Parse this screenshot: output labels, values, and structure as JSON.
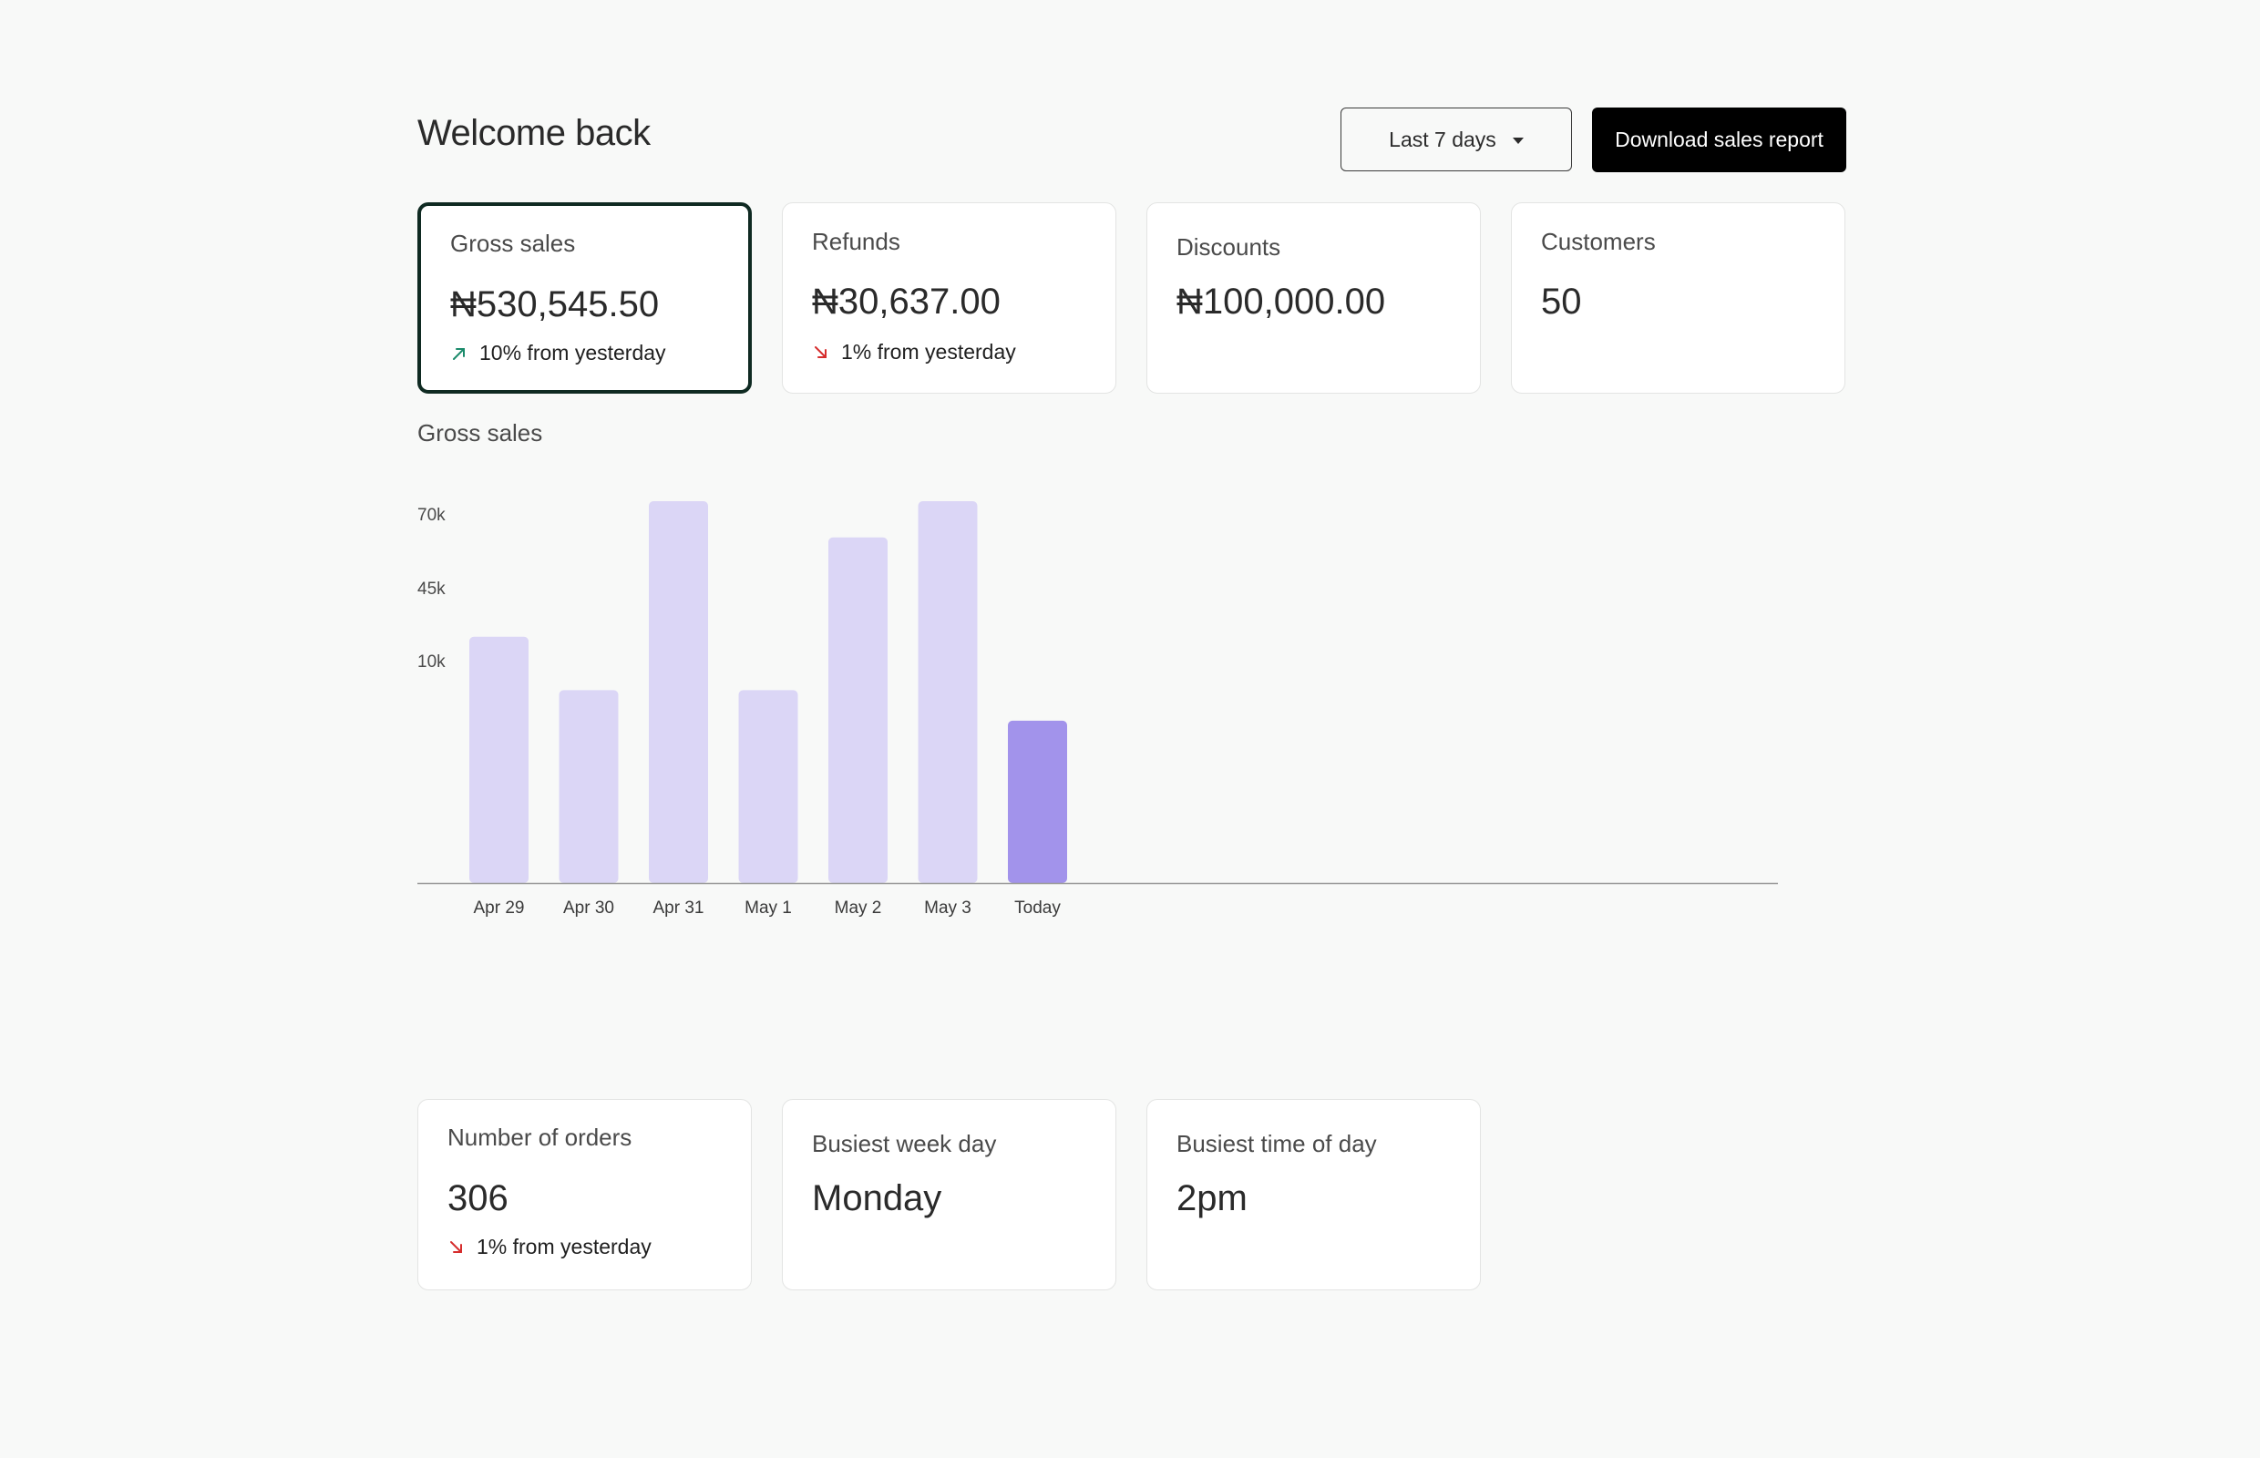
{
  "header": {
    "title": "Welcome back",
    "range_label": "Last 7 days",
    "download_label": "Download sales report"
  },
  "colors": {
    "selected_border": "#0f2a22",
    "bar": "#dbd6f6",
    "bar_highlight": "#a293eb",
    "up": "#1a8a6a",
    "down": "#d62d2d"
  },
  "stats": [
    {
      "label": "Gross sales",
      "value": "₦530,545.50",
      "delta": "10% from yesterday",
      "trend": "up",
      "selected": true
    },
    {
      "label": "Refunds",
      "value": "₦30,637.00",
      "delta": "1% from yesterday",
      "trend": "down"
    },
    {
      "label": "Discounts",
      "value": "₦100,000.00"
    },
    {
      "label": "Customers",
      "value": "50"
    }
  ],
  "chart_section_title": "Gross sales",
  "chart_data": {
    "type": "bar",
    "categories": [
      "Apr 29",
      "Apr 30",
      "Apr 31",
      "May 1",
      "May 2",
      "May 3",
      "Today"
    ],
    "values": [
      0.645,
      0.505,
      1.0,
      0.505,
      0.905,
      1.0,
      0.425
    ],
    "value_scale": "bar height as fraction of tallest bar",
    "highlight_index": 6,
    "yticks": [
      "70k",
      "45k",
      "10k"
    ],
    "grid": false
  },
  "stats2": [
    {
      "label": "Number of orders",
      "value": "306",
      "delta": "1% from yesterday",
      "trend": "down"
    },
    {
      "label": "Busiest week day",
      "value": "Monday"
    },
    {
      "label": "Busiest time of day",
      "value": "2pm"
    }
  ]
}
